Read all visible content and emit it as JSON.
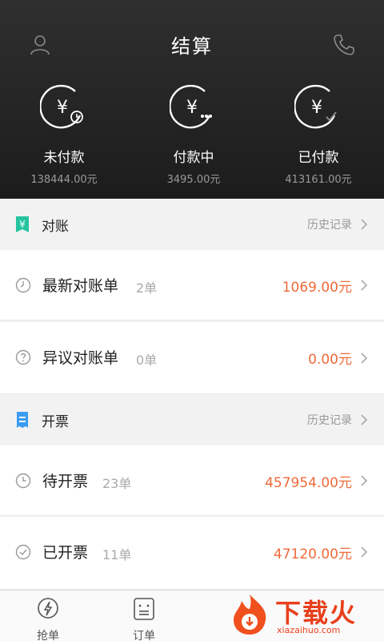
{
  "header": {
    "title": "结算",
    "left_icon": "user-icon",
    "right_icon": "phone-icon",
    "stats": [
      {
        "label": "未付款",
        "amount": "138444.00元",
        "icon": "yuan-clock-icon"
      },
      {
        "label": "付款中",
        "amount": "3495.00元",
        "icon": "yuan-pending-icon"
      },
      {
        "label": "已付款",
        "amount": "413161.00元",
        "icon": "yuan-check-icon"
      }
    ]
  },
  "reconcile": {
    "title": "对账",
    "history": "历史记录",
    "icon": "yuan-tag-icon",
    "accent": "#25c4a0",
    "rows": [
      {
        "title": "最新对账单",
        "count": "2单",
        "amount": "1069.00元",
        "icon": "clock-icon"
      },
      {
        "title": "异议对账单",
        "count": "0单",
        "amount": "0.00元",
        "icon": "question-icon"
      }
    ]
  },
  "invoice": {
    "title": "开票",
    "history": "历史记录",
    "icon": "receipt-icon",
    "accent": "#3b9bf0",
    "rows": [
      {
        "title": "待开票",
        "count": "23单",
        "amount": "457954.00元",
        "icon": "clock-icon"
      },
      {
        "title": "已开票",
        "count": "11单",
        "amount": "47120.00元",
        "icon": "check-circle-icon"
      }
    ]
  },
  "tabbar": {
    "tabs": [
      {
        "label": "抢单",
        "icon": "lightning-icon"
      },
      {
        "label": "订单",
        "icon": "order-list-icon"
      }
    ]
  },
  "watermark": {
    "text": "下载火",
    "url": "xiazaihuo.com"
  },
  "colors": {
    "amount": "#ef6a3a",
    "header_bg": "#222222"
  }
}
